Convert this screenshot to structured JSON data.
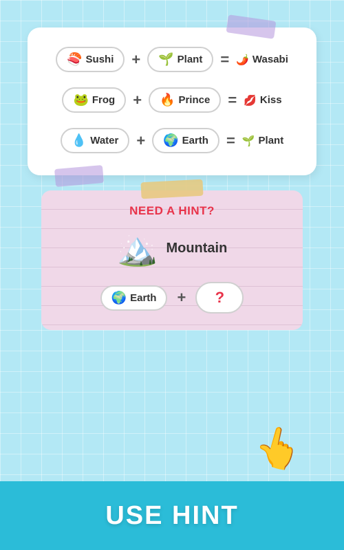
{
  "background": {
    "color": "#b3e8f5"
  },
  "equations": [
    {
      "left1_emoji": "🍣",
      "left1_label": "Sushi",
      "left2_emoji": "🌱",
      "left2_label": "Plant",
      "result_emoji": "🌶️",
      "result_label": "Wasabi"
    },
    {
      "left1_emoji": "🐸",
      "left1_label": "Frog",
      "left2_emoji": "🔥",
      "left2_label": "Prince",
      "result_emoji": "💋",
      "result_label": "Kiss"
    },
    {
      "left1_emoji": "💧",
      "left1_label": "Water",
      "left2_emoji": "🌍",
      "left2_label": "Earth",
      "result_emoji": "🌱",
      "result_label": "Plant"
    }
  ],
  "hint": {
    "title": "NEED A HINT?",
    "answer_emoji": "🏔️",
    "answer_label": "Mountain",
    "eq_emoji": "🌍",
    "eq_label": "Earth",
    "plus": "+",
    "question": "?"
  },
  "bottom_bar": {
    "label": "USE HINT"
  },
  "operators": {
    "plus": "+",
    "equals": "="
  }
}
